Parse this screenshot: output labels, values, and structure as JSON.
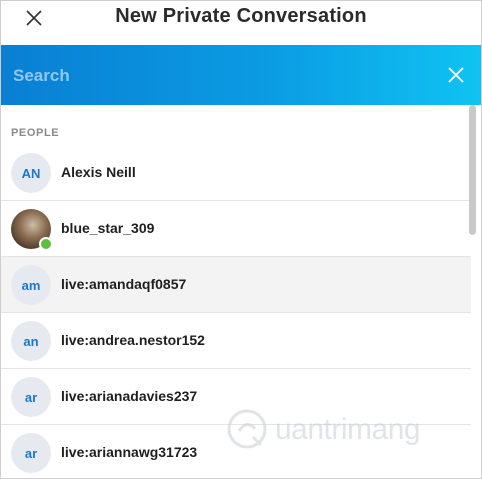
{
  "window": {
    "title": "New Private Conversation"
  },
  "search": {
    "placeholder": "Search",
    "value": ""
  },
  "section": {
    "label": "PEOPLE"
  },
  "contacts": [
    {
      "initials": "AN",
      "name": "Alexis Neill"
    },
    {
      "initials": "",
      "name": "blue_star_309",
      "status": "online"
    },
    {
      "initials": "am",
      "name": "live:amandaqf0857"
    },
    {
      "initials": "an",
      "name": "live:andrea.nestor152"
    },
    {
      "initials": "ar",
      "name": "live:arianadavies237"
    },
    {
      "initials": "ar",
      "name": "live:ariannawg31723"
    }
  ],
  "watermark": {
    "text": "uantrimang"
  },
  "colors": {
    "accent_start": "#0a7fd3",
    "accent_end": "#0fc3f2",
    "initials": "#1a78c9",
    "presence": "#5fbf3f"
  }
}
